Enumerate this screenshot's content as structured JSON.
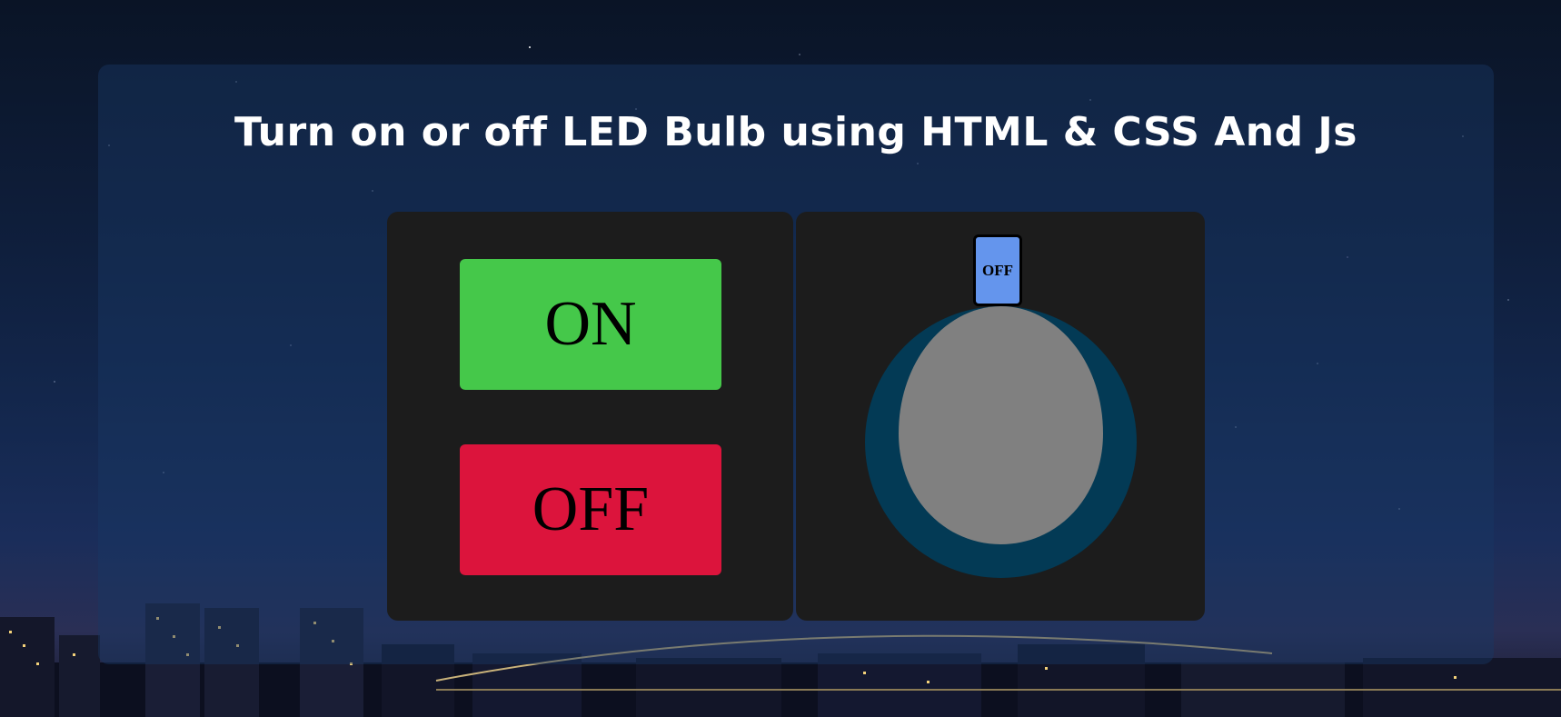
{
  "page": {
    "title": "Turn on or off LED Bulb using HTML & CSS And Js"
  },
  "controls": {
    "on_label": "ON",
    "off_label": "OFF"
  },
  "bulb": {
    "state_label": "OFF",
    "state": "off",
    "colors": {
      "cap": "#6495ed",
      "glass_off": "#808080",
      "ring": "#033a55"
    }
  },
  "colors": {
    "on_button": "#45c84a",
    "off_button": "#dc143c",
    "box_bg": "#1c1c1c"
  }
}
